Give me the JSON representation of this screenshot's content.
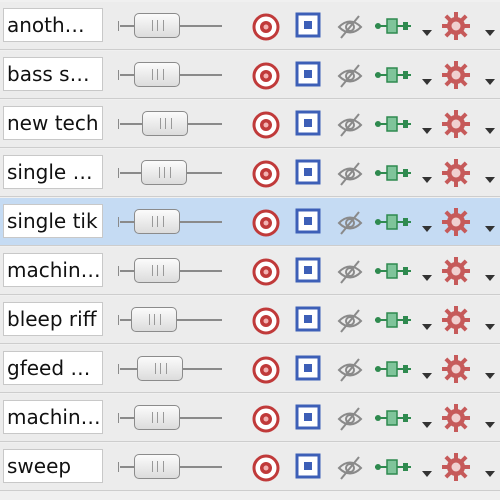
{
  "tracks": [
    {
      "name": "anoth…",
      "volume": 0.25,
      "selected": false
    },
    {
      "name": "bass s…",
      "volume": 0.25,
      "selected": false
    },
    {
      "name": "new tech",
      "volume": 0.4,
      "selected": false
    },
    {
      "name": "single …",
      "volume": 0.38,
      "selected": false
    },
    {
      "name": "single tik",
      "volume": 0.25,
      "selected": true
    },
    {
      "name": "machin…",
      "volume": 0.25,
      "selected": false
    },
    {
      "name": "bleep riff",
      "volume": 0.2,
      "selected": false
    },
    {
      "name": "gfeed …",
      "volume": 0.3,
      "selected": false
    },
    {
      "name": "machin…",
      "volume": 0.25,
      "selected": false
    },
    {
      "name": "sweep",
      "volume": 0.25,
      "selected": false
    }
  ],
  "icons": {
    "record": "record-arm-icon",
    "monitor": "monitor-icon",
    "hide": "hide-eye-icon",
    "routing": "routing-icon",
    "routing_menu": "chevron-down-icon",
    "settings": "gear-icon",
    "settings_menu": "chevron-down-icon"
  },
  "colors": {
    "row_bg": "#ececec",
    "row_selected_bg": "#c5dbf3",
    "record_red": "#c0392b",
    "monitor_blue": "#3d5fb7",
    "routing_green": "#3a9a5a",
    "gear_red": "#c65a5a"
  }
}
